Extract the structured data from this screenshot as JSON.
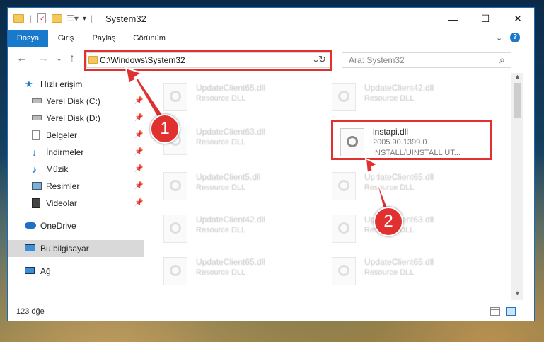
{
  "window": {
    "title": "System32"
  },
  "window_controls": {
    "minimize": "—",
    "maximize": "☐",
    "close": "✕"
  },
  "ribbon": {
    "tabs": [
      {
        "label": "Dosya",
        "active": true
      },
      {
        "label": "Giriş"
      },
      {
        "label": "Paylaş"
      },
      {
        "label": "Görünüm"
      }
    ],
    "help": "?"
  },
  "address": {
    "path": "C:\\Windows\\System32",
    "dropdown": "⌄",
    "refresh": "↻"
  },
  "search": {
    "placeholder": "Ara: System32",
    "icon": "⌕"
  },
  "nav_buttons": {
    "back": "←",
    "forward": "→",
    "recent": "⌄",
    "up": "↑"
  },
  "sidebar": {
    "items": [
      {
        "label": "Hızlı erişim",
        "icon": "star-icon"
      },
      {
        "label": "Yerel Disk (C:)",
        "icon": "drive-icon",
        "pinned": true
      },
      {
        "label": "Yerel Disk (D:)",
        "icon": "drive-icon",
        "pinned": true
      },
      {
        "label": "Belgeler",
        "icon": "document-icon",
        "pinned": true
      },
      {
        "label": "İndirmeler",
        "icon": "download-icon",
        "pinned": true
      },
      {
        "label": "Müzik",
        "icon": "music-icon",
        "pinned": true
      },
      {
        "label": "Resimler",
        "icon": "pictures-icon",
        "pinned": true
      },
      {
        "label": "Videolar",
        "icon": "video-icon",
        "pinned": true
      },
      {
        "label": "OneDrive",
        "icon": "cloud-icon"
      },
      {
        "label": "Bu bilgisayar",
        "icon": "computer-icon",
        "selected": true
      },
      {
        "label": "Ağ",
        "icon": "network-icon"
      }
    ]
  },
  "files": [
    {
      "name": "UpdateClient65.dll",
      "desc": "Resource DLL"
    },
    {
      "name": "UpdateClient42.dll",
      "desc": "Resource DLL"
    },
    {
      "name": "UpdateClient63.dll",
      "desc": "Resource DLL"
    },
    {
      "name": "instapi.dll",
      "version": "2005.90.1399.0",
      "desc": "INSTALL/UINSTALL UT..."
    },
    {
      "name": "UpdateClient5.dll",
      "desc": "Resource DLL"
    },
    {
      "name": "UpdateClient65.dll",
      "desc": "Resource DLL"
    },
    {
      "name": "UpdateClient42.dll",
      "desc": "Resource DLL"
    },
    {
      "name": "UpdateClient63.dll",
      "desc": "Resource DLL"
    },
    {
      "name": "UpdateClient65.dll",
      "desc": "Resource DLL"
    },
    {
      "name": "UpdateClient65.dll",
      "desc": "Resource DLL"
    }
  ],
  "status": {
    "count": "123 öğe"
  },
  "callouts": {
    "one": "1",
    "two": "2"
  },
  "colors": {
    "accent": "#1979ca",
    "highlight": "#e03030"
  }
}
